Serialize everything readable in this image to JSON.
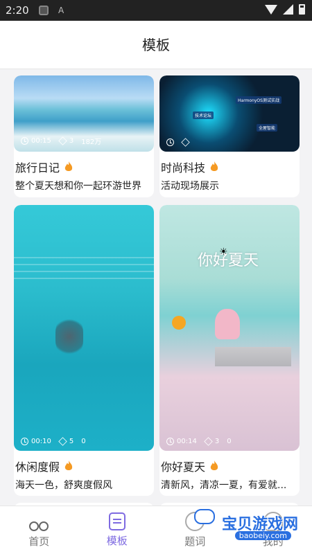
{
  "status_bar": {
    "time": "2:20"
  },
  "header": {
    "title": "模板"
  },
  "cards": [
    {
      "title": "旅行日记",
      "subtitle": "整个夏天想和你一起环游世界",
      "duration": "00:15",
      "clips": "3",
      "views": "182万"
    },
    {
      "title": "时尚科技",
      "subtitle": "活动现场展示",
      "duration": "",
      "clips": "",
      "views": "",
      "tech_labels": [
        "HarmonyOS测试实战",
        "技术论坛",
        "全屋智能"
      ]
    },
    {
      "title": "休闲度假",
      "subtitle": "海天一色，舒爽度假风",
      "duration": "00:10",
      "clips": "5",
      "views": "0"
    },
    {
      "title": "你好夏天",
      "subtitle": "清新风，清凉一夏，有爱就...",
      "duration": "00:14",
      "clips": "3",
      "views": "0",
      "overlay_text": "你好夏天"
    }
  ],
  "nav": {
    "items": [
      {
        "label": "首页",
        "icon": "scissors-icon"
      },
      {
        "label": "模板",
        "icon": "template-icon"
      },
      {
        "label": "题词",
        "icon": "topic-icon"
      },
      {
        "label": "我的",
        "icon": "mine-icon"
      }
    ],
    "active_color": "#7e6ae1"
  },
  "watermark": {
    "text": "宝贝游戏网",
    "url": "baobeiy.com"
  }
}
